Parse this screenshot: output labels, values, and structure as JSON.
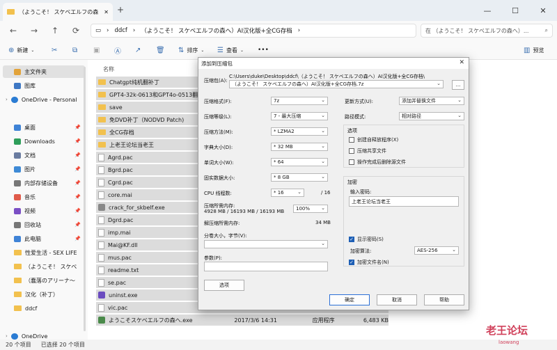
{
  "window": {
    "tab_title": "（ようこそ！ スケベエルフの森",
    "new_tab": "+",
    "minimize": "—",
    "maximize": "☐",
    "close": "✕"
  },
  "address": {
    "segments": [
      "ddcf",
      "（ようこそ！ スケベエルフの森へ）AI汉化版+全CG存档"
    ],
    "search_placeholder": "在 （ようこそ！ スケベエルフの森へ）...",
    "search_icon": "search-icon"
  },
  "nav": {
    "back": "←",
    "forward": "→",
    "up": "↑",
    "refresh": "⟳",
    "monitor": "▭",
    "chevron": "›"
  },
  "toolbar": {
    "new_label": "新建",
    "sort_label": "排序",
    "view_label": "查看",
    "more": "•••",
    "preview_label": "预览"
  },
  "sidebar": {
    "items": [
      {
        "label": "主文件夹",
        "icon": "home-icon",
        "color": "#e2a33b"
      },
      {
        "label": "图库",
        "icon": "gallery-icon",
        "color": "#3e78c4"
      },
      {
        "label": "OneDrive - Personal",
        "icon": "cloud-icon",
        "color": "#2b7cd3"
      },
      {
        "label": "桌面",
        "icon": "desktop-icon",
        "color": "#3f83d6"
      },
      {
        "label": "Downloads",
        "icon": "download-icon",
        "color": "#2e9e5a"
      },
      {
        "label": "文档",
        "icon": "document-icon",
        "color": "#6a7ca0"
      },
      {
        "label": "图片",
        "icon": "pictures-icon",
        "color": "#3e8ad6"
      },
      {
        "label": "内部存储设备",
        "icon": "drive-icon",
        "color": "#777777"
      },
      {
        "label": "音乐",
        "icon": "music-icon",
        "color": "#e05b4b"
      },
      {
        "label": "视频",
        "icon": "video-icon",
        "color": "#7b4fc5"
      },
      {
        "label": "回收站",
        "icon": "recycle-bin-icon",
        "color": "#777777"
      },
      {
        "label": "此电脑",
        "icon": "computer-icon",
        "color": "#3f83d6"
      },
      {
        "label": "性爱生活 - SEX LIFE",
        "icon": "folder-icon",
        "color": "#f2c14e"
      },
      {
        "label": "（ようこそ！ スケベ",
        "icon": "folder-icon",
        "color": "#f2c14e"
      },
      {
        "label": "（蠢落のアリーナ～",
        "icon": "folder-icon",
        "color": "#f2c14e"
      },
      {
        "label": "汉化（补丁）",
        "icon": "folder-icon",
        "color": "#f2c14e"
      },
      {
        "label": "ddcf",
        "icon": "folder-icon",
        "color": "#f2c14e"
      },
      {
        "label": "OneDrive",
        "icon": "cloud-icon",
        "color": "#2b7cd3"
      }
    ]
  },
  "list": {
    "column_header": "名称",
    "files": [
      {
        "name": "Chatgpt纯机翻补丁",
        "type": "folder"
      },
      {
        "name": "GPT4-32k-0613和GPT4o-0513翻译补",
        "type": "folder"
      },
      {
        "name": "save",
        "type": "folder"
      },
      {
        "name": "免DVD补丁（NODVD Patch)",
        "type": "folder"
      },
      {
        "name": "全CG存档",
        "type": "folder"
      },
      {
        "name": "上老王论坛当老王",
        "type": "folder"
      },
      {
        "name": "Agrd.pac",
        "type": "file"
      },
      {
        "name": "Bgrd.pac",
        "type": "file"
      },
      {
        "name": "Cgrd.pac",
        "type": "file"
      },
      {
        "name": "core.mai",
        "type": "file"
      },
      {
        "name": "crack_for_skbelf.exe",
        "type": "exe"
      },
      {
        "name": "Dgrd.pac",
        "type": "file"
      },
      {
        "name": "imp.mai",
        "type": "file"
      },
      {
        "name": "Mai@KF.dll",
        "type": "file"
      },
      {
        "name": "mus.pac",
        "type": "file"
      },
      {
        "name": "readme.txt",
        "type": "file"
      },
      {
        "name": "se.pac",
        "type": "file"
      },
      {
        "name": "uninst.exe",
        "type": "exe"
      },
      {
        "name": "vic.pac",
        "type": "file"
      },
      {
        "name": "ようこそスケベエルフの森へ.exe",
        "type": "exe",
        "date": "2017/3/6 14:31",
        "kind": "应用程序",
        "size": "6,483 KB"
      }
    ]
  },
  "status": {
    "count": "20 个项目",
    "selected": "已选择 20 个项目"
  },
  "dialog": {
    "title": "添加到压缩包",
    "close": "✕",
    "archive_label": "压缩包(A):",
    "archive_dir": "C:\\Users\\duke\\Desktop\\ddcf\\（ようこそ！ スケベエルフの森へ）AI汉化版+全CG存档\\",
    "archive_name": "（ようこそ！ スケベエルフの森へ）AI汉化版+全CG存档.7z",
    "browse": "...",
    "format_label": "压缩格式(F):",
    "format_value": "7z",
    "level_label": "压缩等级(L):",
    "level_value": "7 - 最大压缩",
    "method_label": "压缩方法(M):",
    "method_value": "* LZMA2",
    "dict_label": "字典大小(D):",
    "dict_value": "* 32 MB",
    "word_label": "单词大小(W):",
    "word_value": "* 64",
    "solid_label": "固实数据大小:",
    "solid_value": "* 8 GB",
    "threads_label": "CPU 线程数:",
    "threads_value": "* 16",
    "threads_max": "/ 16",
    "mem_label": "压缩所需内存:",
    "mem_values": "4928 MB / 16193 MB / 16193 MB",
    "mem_pct": "100%",
    "decomp_label": "解压缩所需内存:",
    "decomp_value": "34 MB",
    "split_label": "分卷大小，字节(V):",
    "params_label": "参数(P):",
    "options_button": "选项",
    "update_label": "更新方式(U):",
    "update_value": "添加并替换文件",
    "path_label": "路径模式:",
    "path_value": "相对路径",
    "opts_group": "选项",
    "opt_sfx": "创建自释放程序(X)",
    "opt_shared": "压缩共享文件",
    "opt_delete": "操作完成后删除源文件",
    "enc_group": "加密",
    "pwd_label": "输入密码:",
    "pwd_value": "上老王论坛当老王",
    "show_pwd": "显示密码(S)",
    "enc_method_label": "加密算法:",
    "enc_method_value": "AES-256",
    "enc_names": "加密文件名(N)",
    "ok": "确定",
    "cancel": "取消",
    "help": "帮助"
  },
  "watermark": {
    "text": "老王论坛",
    "sub": "laowang"
  }
}
